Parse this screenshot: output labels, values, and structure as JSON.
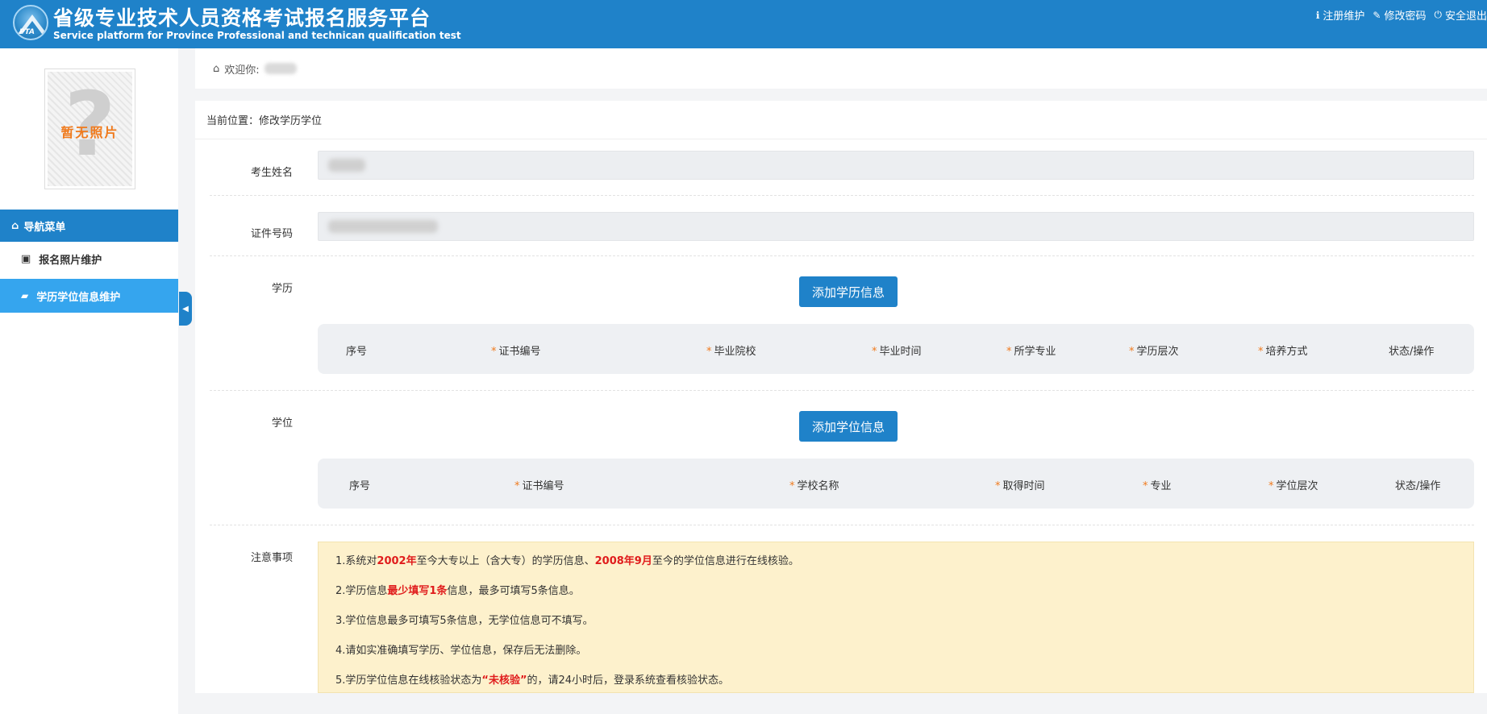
{
  "header": {
    "logo_text": "PTA",
    "title_cn": "省级专业技术人员资格考试报名服务平台",
    "title_en": "Service platform for Province Professional and technican qualification test",
    "links": [
      {
        "icon": "info-circle-icon",
        "glyph": "ℹ",
        "label": "注册维护"
      },
      {
        "icon": "edit-icon",
        "glyph": "✎",
        "label": "修改密码"
      },
      {
        "icon": "power-icon",
        "glyph": "⏻",
        "label": "安全退出"
      }
    ]
  },
  "sidebar": {
    "photo_placeholder": "暂无照片",
    "photo_glyph": "?",
    "nav_header": "导航菜单",
    "items": [
      {
        "icon": "image-icon",
        "glyph": "▣",
        "label": "报名照片维护",
        "active": false
      },
      {
        "icon": "graduation-cap-icon",
        "glyph": "🎓",
        "label": "学历学位信息维护",
        "active": true
      }
    ]
  },
  "welcome": {
    "icon": "bank-icon",
    "glyph": "🏛",
    "label": "欢迎你:"
  },
  "breadcrumb": "当前位置：修改学历学位",
  "form": {
    "name_label": "考生姓名",
    "id_label": "证件号码",
    "education": {
      "label": "学历",
      "add_button": "添加学历信息",
      "columns": [
        {
          "label": "序号",
          "required": false
        },
        {
          "label": "证书编号",
          "required": true
        },
        {
          "label": "毕业院校",
          "required": true
        },
        {
          "label": "毕业时间",
          "required": true
        },
        {
          "label": "所学专业",
          "required": true
        },
        {
          "label": "学历层次",
          "required": true
        },
        {
          "label": "培养方式",
          "required": true
        },
        {
          "label": "状态/操作",
          "required": false
        }
      ]
    },
    "degree": {
      "label": "学位",
      "add_button": "添加学位信息",
      "columns": [
        {
          "label": "序号",
          "required": false
        },
        {
          "label": "证书编号",
          "required": true
        },
        {
          "label": "学校名称",
          "required": true
        },
        {
          "label": "取得时间",
          "required": true
        },
        {
          "label": "专业",
          "required": true
        },
        {
          "label": "学位层次",
          "required": true
        },
        {
          "label": "状态/操作",
          "required": false
        }
      ]
    },
    "notice": {
      "label": "注意事项",
      "lines": [
        {
          "a": "1.系统对",
          "b": "2002年",
          "c": "至今大专以上（含大专）的学历信息、",
          "d": "2008年9月",
          "e": "至今的学位信息进行在线核验。"
        },
        {
          "a": "2.学历信息",
          "b": "最少填写1条",
          "c": "信息，最多可填写5条信息。"
        },
        {
          "a": "3.学位信息最多可填写5条信息，无学位信息可不填写。"
        },
        {
          "a": "4.请如实准确填写学历、学位信息，保存后无法删除。"
        },
        {
          "a": "5.学历学位信息在线核验状态为",
          "b": "“未核验”",
          "c": "的，请24小时后，登录系统查看核验状态。"
        }
      ]
    }
  },
  "colors": {
    "primary": "#1f82c9",
    "active": "#35a5ee",
    "required": "#f07a1c",
    "highlight": "#e01c1c",
    "notice_bg": "#fdf1cc"
  }
}
